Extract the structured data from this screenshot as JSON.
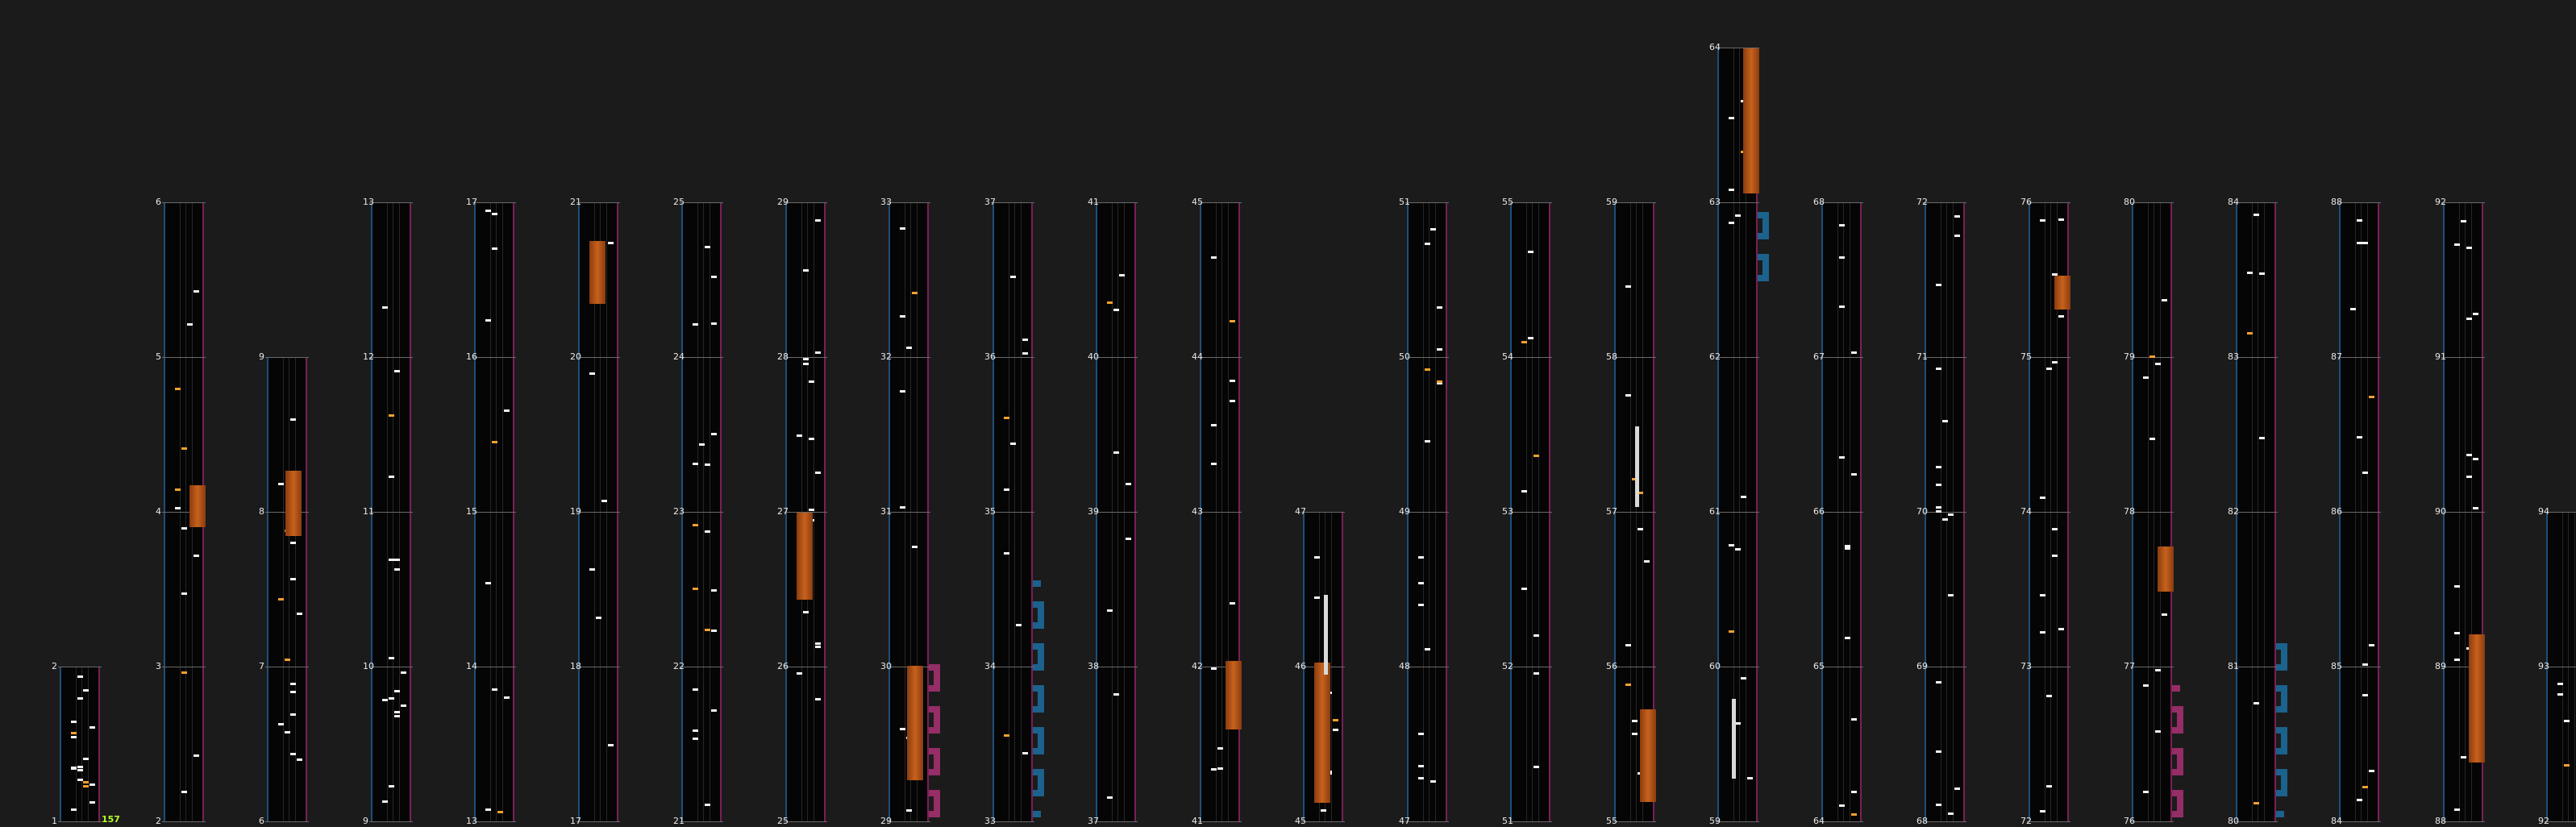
{
  "counter": "157",
  "colors": {
    "blue": "#1c6a9a",
    "pink": "#a3306f",
    "orange": "#c7621c",
    "note": "#f2f2f2"
  },
  "columns": [
    {
      "bars": [
        1,
        2
      ]
    },
    {
      "bars": [
        2,
        3,
        4,
        5,
        6
      ]
    },
    {
      "bars": [
        6,
        7,
        8,
        9
      ]
    },
    {
      "bars": [
        9,
        10,
        11,
        12,
        13
      ]
    },
    {
      "bars": [
        13,
        14,
        15,
        16,
        17
      ]
    },
    {
      "bars": [
        17,
        18,
        19,
        20,
        21
      ]
    },
    {
      "bars": [
        21,
        22,
        23,
        24,
        25
      ]
    },
    {
      "bars": [
        25,
        26,
        27,
        28,
        29
      ]
    },
    {
      "bars": [
        29,
        30,
        31,
        32,
        33
      ]
    },
    {
      "bars": [
        33,
        34,
        35,
        36,
        37
      ]
    },
    {
      "bars": [
        37,
        38,
        39,
        40,
        41
      ]
    },
    {
      "bars": [
        41,
        42,
        43,
        44,
        45
      ]
    },
    {
      "bars": [
        45,
        46,
        47
      ]
    },
    {
      "bars": [
        47,
        48,
        49,
        50,
        51
      ]
    },
    {
      "bars": [
        51,
        52,
        53,
        54,
        55
      ]
    },
    {
      "bars": [
        55,
        56,
        57,
        58,
        59
      ]
    },
    {
      "bars": [
        59,
        60,
        61,
        62,
        63,
        64
      ]
    },
    {
      "bars": [
        64,
        65,
        66,
        67,
        68
      ]
    },
    {
      "bars": [
        68,
        69,
        70,
        71,
        72
      ]
    },
    {
      "bars": [
        72,
        73,
        74,
        75,
        76
      ]
    },
    {
      "bars": [
        76,
        77,
        78,
        79,
        80
      ]
    },
    {
      "bars": [
        80,
        81,
        82,
        83,
        84
      ]
    },
    {
      "bars": [
        84,
        85,
        86,
        87,
        88
      ]
    },
    {
      "bars": [
        88,
        89,
        90,
        91,
        92
      ]
    },
    {
      "bars": [
        92,
        93,
        94
      ]
    }
  ]
}
